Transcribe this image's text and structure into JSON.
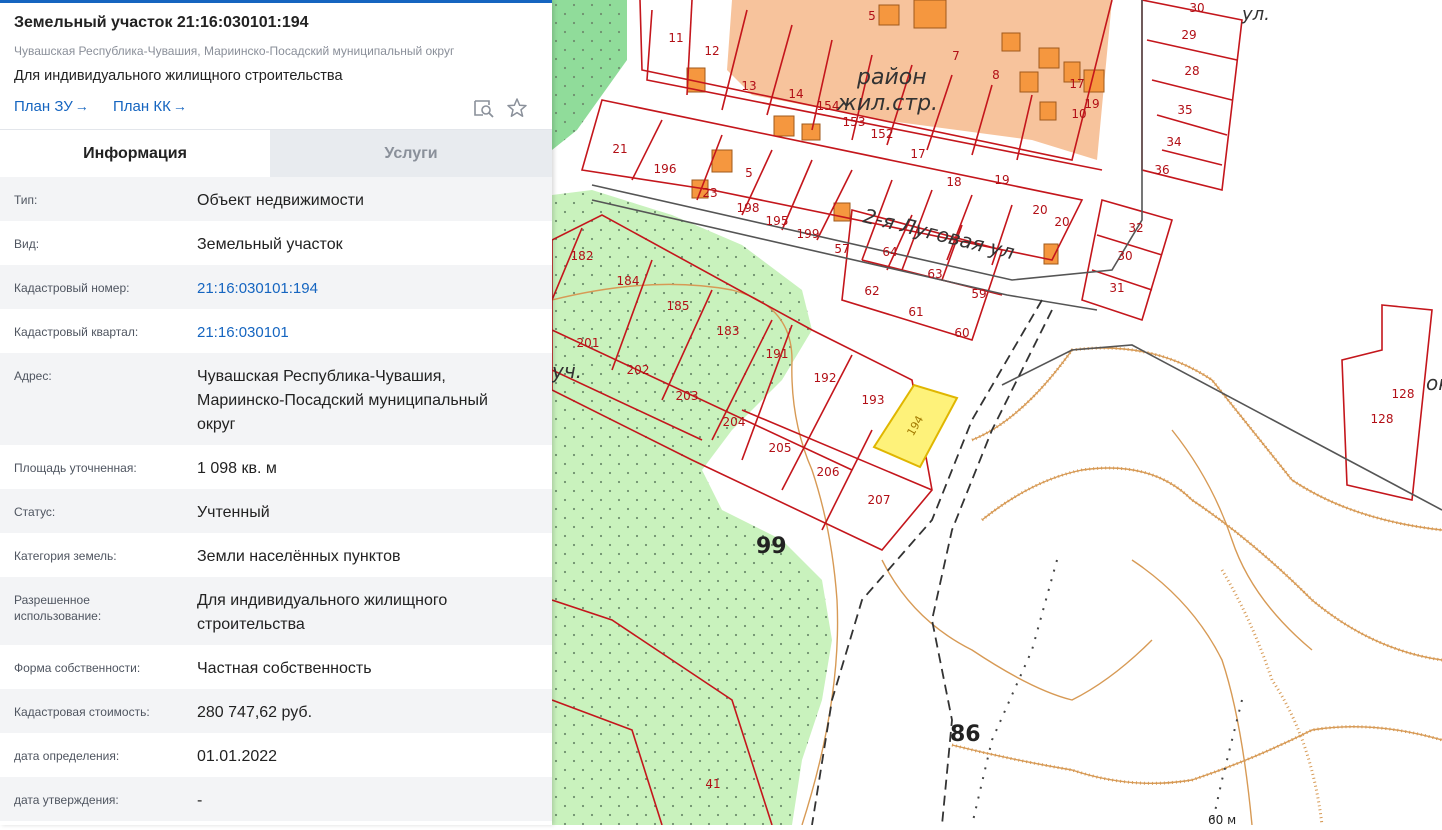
{
  "header": {
    "title": "Земельный участок 21:16:030101:194",
    "subtitle": "Чувашская Республика-Чувашия, Мариинско-Посадский муниципальный округ",
    "purpose": "Для индивидуального жилищного строительства",
    "plan_zu": "План ЗУ",
    "plan_kk": "План КК",
    "link_arrow": "→",
    "icons": {
      "preview": "map-search-icon",
      "favorite": "star-icon"
    }
  },
  "tabs": {
    "info": "Информация",
    "services": "Услуги"
  },
  "info": {
    "type_label": "Тип:",
    "type_value": "Объект недвижимости",
    "kind_label": "Вид:",
    "kind_value": "Земельный участок",
    "cad_num_label": "Кадастровый номер:",
    "cad_num_value": "21:16:030101:194",
    "cad_q_label": "Кадастровый квартал:",
    "cad_q_value": "21:16:030101",
    "addr_label": "Адрес:",
    "addr_value": "Чувашская Республика-Чувашия, Мариинско-Посадский муниципальный округ",
    "area_label": "Площадь уточненная:",
    "area_value": "1 098 кв. м",
    "status_label": "Статус:",
    "status_value": "Учтенный",
    "category_label": "Категория земель:",
    "category_value": "Земли населённых пунктов",
    "usage_label": "Разрешенное использование:",
    "usage_value": "Для индивидуального жилищного строительства",
    "ownership_label": "Форма собственности:",
    "ownership_value": "Частная собственность",
    "cost_label": "Кадастровая стоимость:",
    "cost_value": "280 747,62 руб.",
    "det_date_label": "дата определения:",
    "det_date_value": "01.01.2022",
    "appr_date_label": "дата утверждения:",
    "appr_date_value": "-"
  },
  "map": {
    "selected_parcel": "194",
    "labels": {
      "street_1": "2-я Луговая ул",
      "street_2": "ул.",
      "district_1": "район",
      "district_2": "жил.стр.",
      "uch": "уч.",
      "ok": "ок",
      "area_99": "99",
      "area_86": "86",
      "scale": "60 м"
    },
    "parcel_numbers": [
      "5",
      "7",
      "8",
      "10",
      "11",
      "12",
      "13",
      "14",
      "154",
      "153",
      "152",
      "17",
      "18",
      "19",
      "17",
      "19",
      "20",
      "20",
      "21",
      "196",
      "23",
      "5",
      "198",
      "195",
      "199",
      "57",
      "64",
      "63",
      "62",
      "61",
      "59",
      "60",
      "30",
      "29",
      "28",
      "35",
      "34",
      "36",
      "32",
      "30",
      "31",
      "128",
      "128",
      "182",
      "184",
      "185",
      "183",
      "201",
      "202",
      "203",
      "191",
      "192",
      "193",
      "204",
      "205",
      "206",
      "207",
      "41"
    ],
    "colors": {
      "selected": "#fef27a",
      "parcel_border": "#c4161c",
      "forest": "#c9f2bd",
      "forest_dark": "#90dc9a",
      "building": "#f5973f",
      "residential": "#f7c39c",
      "relief": "#d79a55"
    }
  }
}
